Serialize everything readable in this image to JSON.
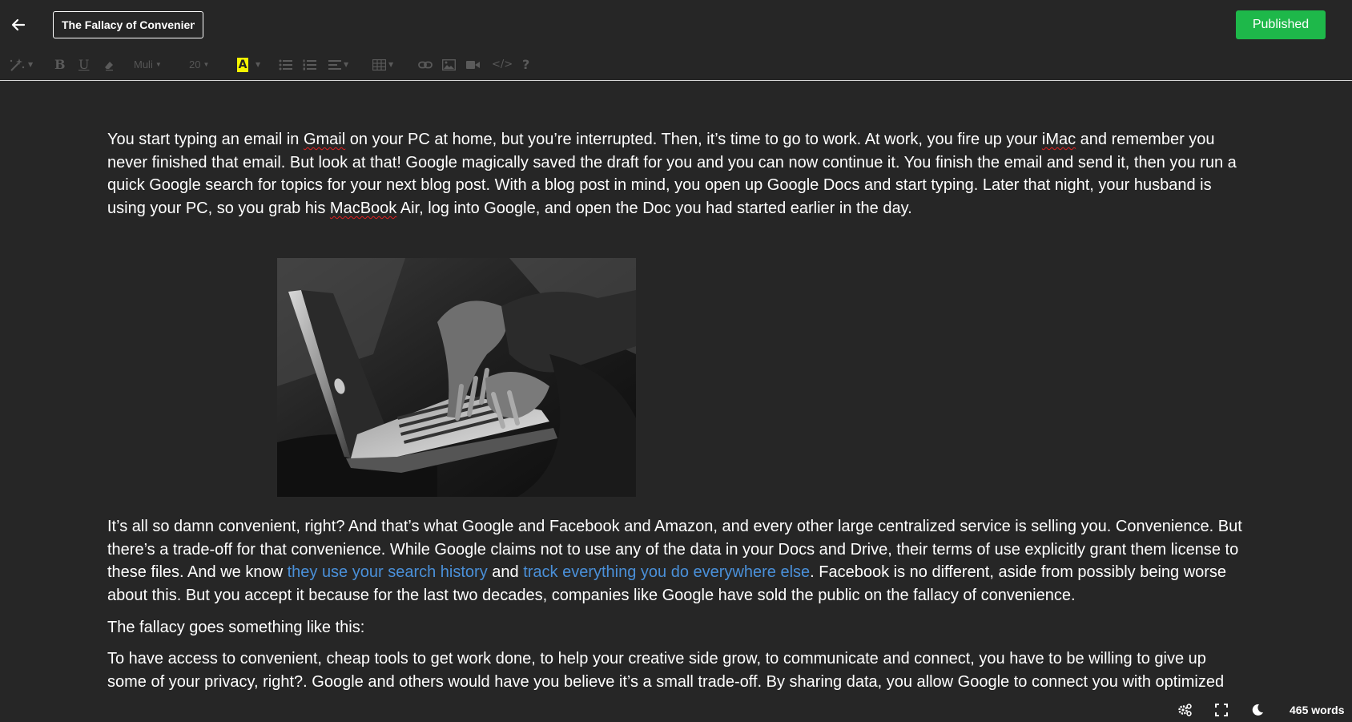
{
  "header": {
    "back_icon": "arrow-left-icon",
    "title_value": "The Fallacy of Convenience",
    "publish_label": "Published",
    "publish_color": "#1eb84a"
  },
  "toolbar": {
    "magic_icon": "magic-wand-icon",
    "bold_label": "B",
    "underline_label": "U",
    "eraser_icon": "eraser-icon",
    "font_name": "Muli",
    "font_size": "20",
    "highlight_label": "A",
    "highlight_color": "#f5f500",
    "bullet_icon": "bullet-list-icon",
    "numbered_icon": "numbered-list-icon",
    "align_icon": "align-left-icon",
    "table_icon": "table-icon",
    "link_icon": "link-icon",
    "image_icon": "image-icon",
    "video_icon": "video-icon",
    "code_label": "</>",
    "help_label": "?"
  },
  "content": {
    "p1": {
      "a": "You start typing an email in ",
      "b": "Gmail",
      "c": " on your PC at home, but you’re interrupted. Then, it’s time to go to work. At work, you fire up your ",
      "d": "iMac",
      "e": " and remember you never finished that email. But look at that! Google magically saved the draft for you and you can now continue it. You finish the email and send it, then you run a quick Google search for topics for your next blog post. With a blog post in mind, you open up Google Docs and start typing. Later that night, your husband is using your PC, so you grab his ",
      "f": "MacBook",
      "g": " Air, log into Google, and open the Doc you had started earlier in the day."
    },
    "image_alt": "Person typing on a laptop in black and white",
    "p2": {
      "a": "It’s all so damn convenient, right? And that’s what Google and Facebook and Amazon, and every other large centralized service is selling you. Convenience. But there’s a trade-off for that convenience. While Google claims not to use any of the data in your Docs and Drive, their terms of use explicitly grant them license to these files. And we know ",
      "link1": "they use your search history",
      "b": " and ",
      "link2": "track everything you do everywhere else",
      "c": ". Facebook is no different, aside from possibly being worse about this. But you accept it because for the last two decades, companies like Google have sold the public on the fallacy of convenience."
    },
    "p3": "The fallacy goes something like this:",
    "p4": "To have access to convenient, cheap tools to get work done, to help your creative side grow, to communicate and connect, you have to be willing to give up some of your privacy, right?. Google and others would have you believe it’s a small trade-off. By sharing data, you allow Google to connect you with optimized",
    "link_color": "#4a90d9"
  },
  "statusbar": {
    "settings_icon": "settings-icon",
    "fullscreen_icon": "fullscreen-icon",
    "darkmode_icon": "moon-icon",
    "word_count": "465 words"
  }
}
